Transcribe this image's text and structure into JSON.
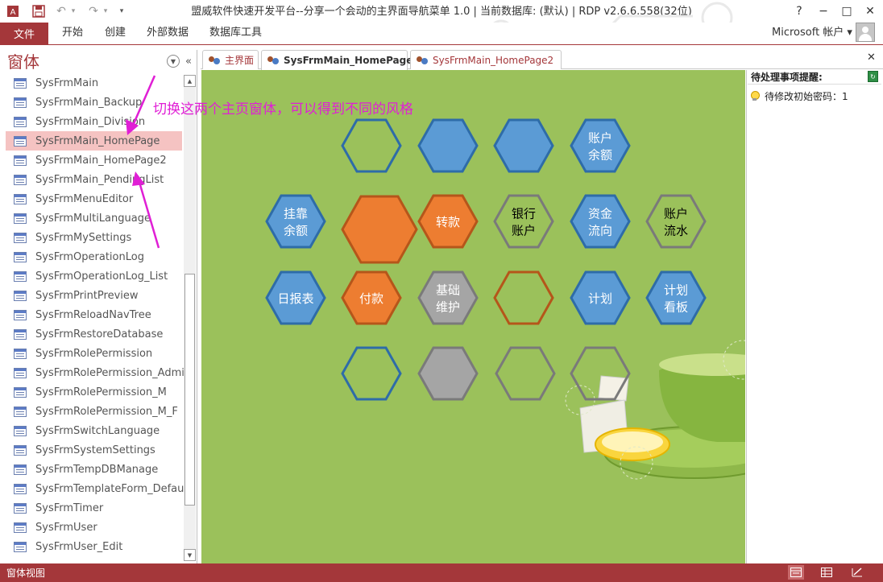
{
  "window": {
    "title": "盟威软件快速开发平台--分享一个会动的主界面导航菜单 1.0 | 当前数据库: (默认) | RDP v2.6.6.558(32位)",
    "help": "?",
    "minimize": "−",
    "restore": "□",
    "close": "✕"
  },
  "qat": {
    "undo": "↶",
    "undo_more": "▾",
    "redo": "↷",
    "redo_more": "▾",
    "customize": "▾"
  },
  "ribbon": {
    "file_tab": "文件",
    "tabs": [
      "开始",
      "创建",
      "外部数据",
      "数据库工具"
    ],
    "account": "Microsoft 帐户 ▾"
  },
  "nav": {
    "title": "窗体",
    "menu_icon": "▼",
    "collapse_icon": "«",
    "items": [
      "SysFrmMain",
      "SysFrmMain_Backup",
      "SysFrmMain_Division",
      "SysFrmMain_HomePage",
      "SysFrmMain_HomePage2",
      "SysFrmMain_PendingList",
      "SysFrmMenuEditor",
      "SysFrmMultiLanguage",
      "SysFrmMySettings",
      "SysFrmOperationLog",
      "SysFrmOperationLog_List",
      "SysFrmPrintPreview",
      "SysFrmReloadNavTree",
      "SysFrmRestoreDatabase",
      "SysFrmRolePermission",
      "SysFrmRolePermission_Admin",
      "SysFrmRolePermission_M",
      "SysFrmRolePermission_M_F",
      "SysFrmSwitchLanguage",
      "SysFrmSystemSettings",
      "SysFrmTempDBManage",
      "SysFrmTemplateForm_Default",
      "SysFrmTimer",
      "SysFrmUser",
      "SysFrmUser_Edit"
    ],
    "selected_index": 3,
    "scroll_up": "▲",
    "scroll_down": "▼"
  },
  "doc_tabs": [
    {
      "label": "主界面",
      "active": false,
      "color": "#a4373a"
    },
    {
      "label": "SysFrmMain_HomePage",
      "active": true,
      "color": "#a4373a"
    },
    {
      "label": "SysFrmMain_HomePage2",
      "active": false,
      "color": "#a4373a"
    }
  ],
  "doc_close": "✕",
  "annotation": "切换这两个主页窗体，可以得到不同的风格",
  "hex_tiles": [
    {
      "label": "",
      "style": "outline-blue"
    },
    {
      "label": "",
      "style": "fill-blue"
    },
    {
      "label": "",
      "style": "fill-blue"
    },
    {
      "label": "账户\n余额",
      "style": "fill-blue"
    },
    {
      "label": "挂靠\n余额",
      "style": "fill-blue"
    },
    {
      "label": "",
      "style": "fill-orange-large"
    },
    {
      "label": "转款",
      "style": "fill-orange"
    },
    {
      "label": "银行\n账户",
      "style": "outline-gray"
    },
    {
      "label": "资金\n流向",
      "style": "fill-blue"
    },
    {
      "label": "账户\n流水",
      "style": "outline-gray"
    },
    {
      "label": "日报表",
      "style": "fill-blue"
    },
    {
      "label": "付款",
      "style": "fill-orange"
    },
    {
      "label": "基础\n维护",
      "style": "fill-gray"
    },
    {
      "label": "",
      "style": "outline-orange"
    },
    {
      "label": "计划",
      "style": "fill-blue"
    },
    {
      "label": "计划\n看板",
      "style": "fill-blue"
    },
    {
      "label": "",
      "style": "outline-blue"
    },
    {
      "label": "",
      "style": "fill-gray"
    },
    {
      "label": "",
      "style": "outline-gray"
    },
    {
      "label": "",
      "style": "outline-gray"
    }
  ],
  "right_panel": {
    "title": "待处理事项提醒:",
    "items": [
      "待修改初始密码：1"
    ]
  },
  "statusbar": {
    "text": "窗体视图"
  },
  "colors": {
    "accent": "#a4373a",
    "canvas_bg": "#9bc15b",
    "hex_blue": "#5b9bd5",
    "hex_blue_border": "#2e6ca8",
    "hex_orange": "#ed7d31",
    "hex_orange_border": "#b5561a",
    "hex_gray": "#a5a5a5",
    "hex_gray_border": "#7a7a7a",
    "annotation": "#e01fd5"
  }
}
